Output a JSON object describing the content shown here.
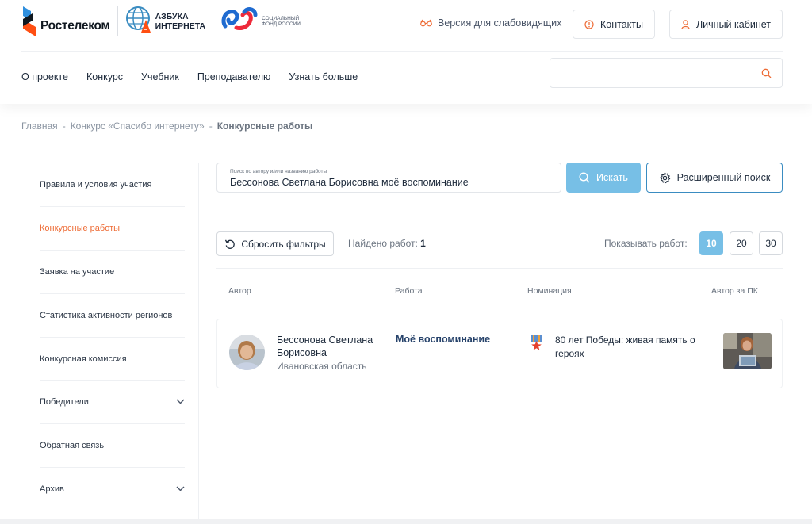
{
  "header": {
    "brand_rostelecom": "Ростелеком",
    "brand_azbuka_line1": "АЗБУКА",
    "brand_azbuka_line2": "ИНТЕРНЕТА",
    "brand_sfr_line1": "СОЦИАЛЬНЫЙ",
    "brand_sfr_line2": "ФОНД РОССИИ",
    "low_vision": "Версия для слабовидящих",
    "contacts": "Контакты",
    "cabinet": "Личный кабинет",
    "accent_color": "#ee6c36"
  },
  "nav": {
    "items": [
      "О проекте",
      "Конкурс",
      "Учебник",
      "Преподавателю",
      "Узнать больше"
    ]
  },
  "top_search": {
    "placeholder": ""
  },
  "breadcrumb": {
    "items": [
      "Главная",
      "Конкурс «Спасибо интернету»",
      "Конкурсные работы"
    ],
    "separator": "-"
  },
  "sidebar": {
    "items": [
      {
        "label": "Правила и условия участия"
      },
      {
        "label": "Конкурсные работы"
      },
      {
        "label": "Заявка на участие"
      },
      {
        "label": "Статистика активности регионов"
      },
      {
        "label": "Конкурсная комиссия"
      },
      {
        "label": "Победители"
      },
      {
        "label": "Обратная связь"
      },
      {
        "label": "Архив"
      }
    ]
  },
  "search": {
    "placeholder": "Поиск по автору и/или названию работы",
    "value": "Бессонова Светлана Борисовна моё воспоминание",
    "button": "Искать",
    "advanced": "Расширенный поиск",
    "button_color": "#77bfe6"
  },
  "filters": {
    "reset": "Сбросить фильтры",
    "found_label": "Найдено работ:",
    "found_count": "1",
    "show_label": "Показывать работ:",
    "page_sizes": [
      "10",
      "20",
      "30"
    ],
    "selected_page_size": "10"
  },
  "table": {
    "headers": [
      "Автор",
      "Работа",
      "Номинация",
      "Автор за ПК"
    ],
    "rows": [
      {
        "author": "Бессонова Светлана Борисовна",
        "region": "Ивановская область",
        "work": "Моё воспоминание",
        "nomination": "80 лет Победы: живая память о героях"
      }
    ]
  }
}
